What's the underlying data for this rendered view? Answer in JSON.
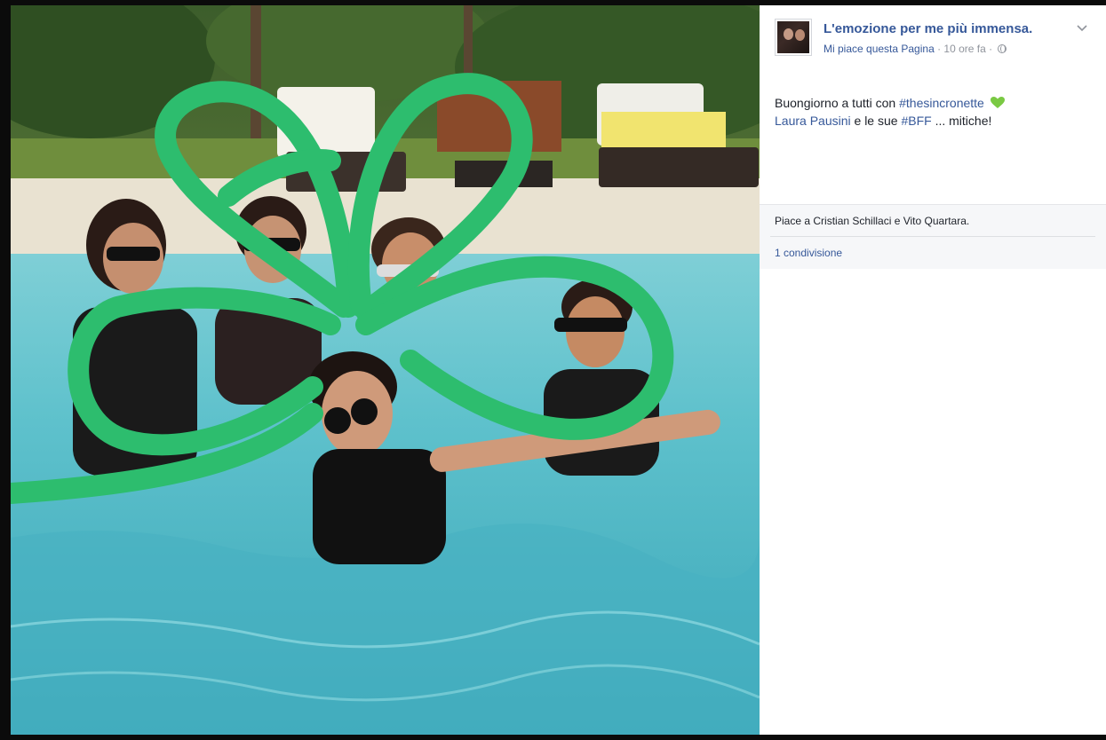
{
  "post": {
    "page_name": "L'emozione per me più immensa.",
    "like_page": "Mi piace questa Pagina",
    "separator": " · ",
    "time": "10 ore fa",
    "separator2": " · ",
    "text": {
      "greeting": "Buongiorno a tutti con ",
      "hashtag1": "#thesincronette",
      "mention": "Laura Pausini",
      "middle": " e le sue ",
      "hashtag2": "#BFF",
      "ending": " ... mitiche!"
    },
    "likes": "Piace a Cristian Schillaci e Vito Quartara.",
    "shares": "1 condivisione",
    "options_icon": "chevron-down-icon",
    "privacy_icon": "globe-icon",
    "emoji": "green-heart-icon"
  },
  "colors": {
    "link": "#365899",
    "meta": "#90949c",
    "text": "#1d2129",
    "pool_water": "#4fb7c7",
    "noodle_green": "#2dbd6e"
  }
}
